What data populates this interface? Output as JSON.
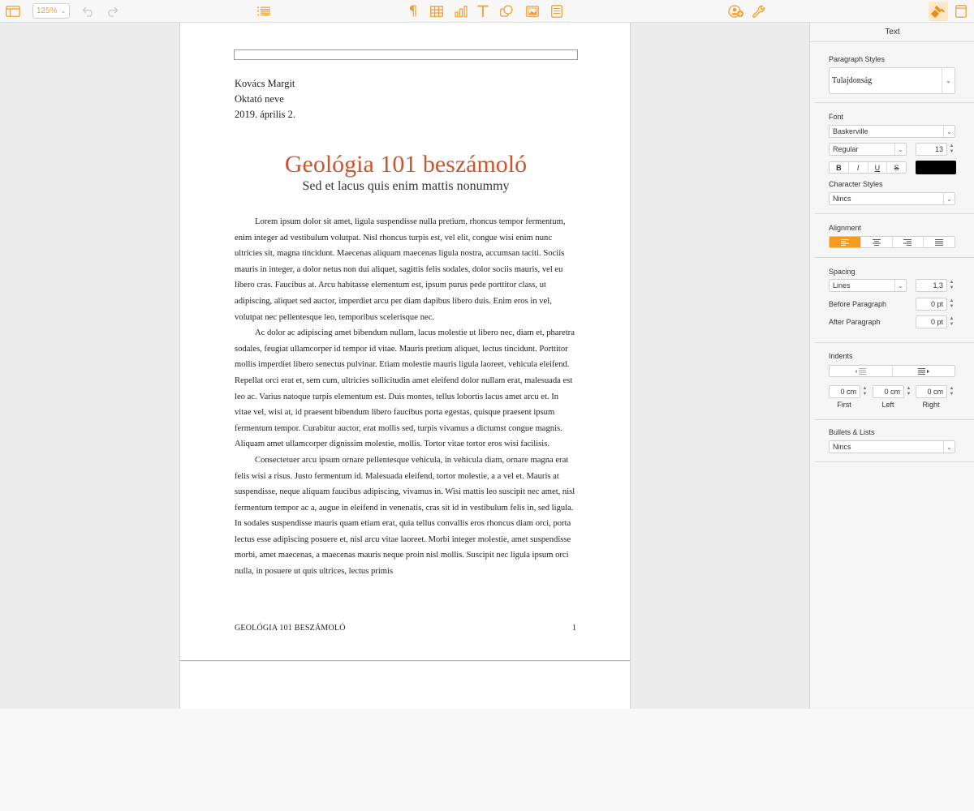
{
  "toolbar": {
    "zoom": "125%",
    "colors": {
      "accent": "#f0a030",
      "active_bg": "#fde7c7"
    }
  },
  "document": {
    "sender": [
      "Kovács Margit",
      "Oktató neve",
      "2019. április 2."
    ],
    "title": "Geológia 101 beszámoló",
    "subtitle": "Sed et lacus quis enim mattis nonummy",
    "paragraphs": [
      "Lorem ipsum dolor sit amet, ligula suspendisse nulla pretium, rhoncus tempor fermentum, enim integer ad vestibulum volutpat. Nisl rhoncus turpis est, vel elit, congue wisi enim nunc ultricies sit, magna tincidunt. Maecenas aliquam maecenas ligula nostra, accumsan taciti. Sociis mauris in integer, a dolor netus non dui aliquet, sagittis felis sodales, dolor sociis mauris, vel eu libero cras. Faucibus at. Arcu habitasse elementum est, ipsum purus pede porttitor class, ut adipiscing, aliquet sed auctor, imperdiet arcu per diam dapibus libero duis. Enim eros in vel, volutpat nec pellentesque leo, temporibus scelerisque nec.",
      "Ac dolor ac adipiscing amet bibendum nullam, lacus molestie ut libero nec, diam et, pharetra sodales, feugiat ullamcorper id tempor id vitae. Mauris pretium aliquet, lectus tincidunt. Porttitor mollis imperdiet libero senectus pulvinar. Etiam molestie mauris ligula laoreet, vehicula eleifend. Repellat orci erat et, sem cum, ultricies sollicitudin amet eleifend dolor nullam erat, malesuada est leo ac. Varius natoque turpis elementum est. Duis montes, tellus lobortis lacus amet arcu et. In vitae vel, wisi at, id praesent bibendum libero faucibus porta egestas, quisque praesent ipsum fermentum tempor. Curabitur auctor, erat mollis sed, turpis vivamus a dictumst congue magnis. Aliquam amet ullamcorper dignissim molestie, mollis. Tortor vitae tortor eros wisi facilisis.",
      "Consectetuer arcu ipsum ornare pellentesque vehicula, in vehicula diam, ornare magna erat felis wisi a risus. Justo fermentum id. Malesuada eleifend, tortor molestie, a a vel et. Mauris at suspendisse, neque aliquam faucibus adipiscing, vivamus in. Wisi mattis leo suscipit nec amet, nisl fermentum tempor ac a, augue in eleifend in venenatis, cras sit id in vestibulum felis in, sed ligula. In sodales suspendisse mauris quam etiam erat, quia tellus convallis eros rhoncus diam orci, porta lectus esse adipiscing posuere et, nisl arcu vitae laoreet. Morbi integer molestie, amet suspendisse morbi, amet maecenas, a maecenas mauris neque proin nisl mollis. Suscipit nec ligula ipsum orci nulla, in posuere ut quis ultrices, lectus primis"
    ],
    "footer_left": "GEOLÓGIA 101 BESZÁMOLÓ",
    "footer_right": "1",
    "title_color": "#c9562e"
  },
  "inspector": {
    "title": "Text",
    "paragraph_styles_label": "Paragraph Styles",
    "paragraph_style_value": "Tulajdonság",
    "font_label": "Font",
    "font_family": "Baskerville",
    "font_weight": "Regular",
    "font_size": "13",
    "format_buttons": [
      "B",
      "I",
      "U",
      "S"
    ],
    "text_color": "#000000",
    "character_styles_label": "Character Styles",
    "character_style_value": "Nincs",
    "alignment_label": "Alignment",
    "spacing_label": "Spacing",
    "spacing_mode": "Lines",
    "spacing_value": "1,3",
    "before_paragraph_label": "Before Paragraph",
    "before_paragraph_value": "0 pt",
    "after_paragraph_label": "After Paragraph",
    "after_paragraph_value": "0 pt",
    "indents_label": "Indents",
    "indent_first": "0 cm",
    "indent_left": "0 cm",
    "indent_right": "0 cm",
    "indent_first_label": "First",
    "indent_left_label": "Left",
    "indent_right_label": "Right",
    "bullets_label": "Bullets & Lists",
    "bullets_value": "Nincs",
    "accent_color": "#f59c1f"
  }
}
